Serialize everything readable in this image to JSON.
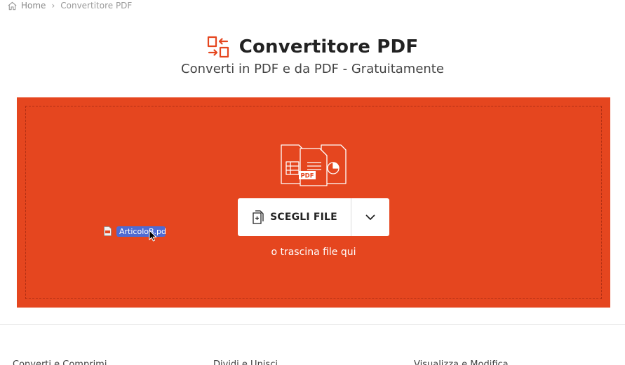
{
  "breadcrumb": {
    "home": "Home",
    "separator": "›",
    "current": "Convertitore PDF"
  },
  "header": {
    "title": "Convertitore PDF",
    "subtitle": "Converti in PDF e da PDF - Gratuitamente",
    "icon": "convert-arrows-icon"
  },
  "dropzone": {
    "background_color": "#e5461f",
    "illustration_badge": "PDF",
    "choose_button_label": "SCEGLI FILE",
    "drop_hint": "o trascina file qui"
  },
  "drag_ghost": {
    "filename": "ArticoloB.pdf"
  },
  "footer": {
    "columns": [
      "Converti e Comprimi",
      "Dividi e Unisci",
      "Visualizza e Modifica"
    ]
  },
  "colors": {
    "accent": "#e5461f",
    "selection": "#4f6bd3"
  }
}
